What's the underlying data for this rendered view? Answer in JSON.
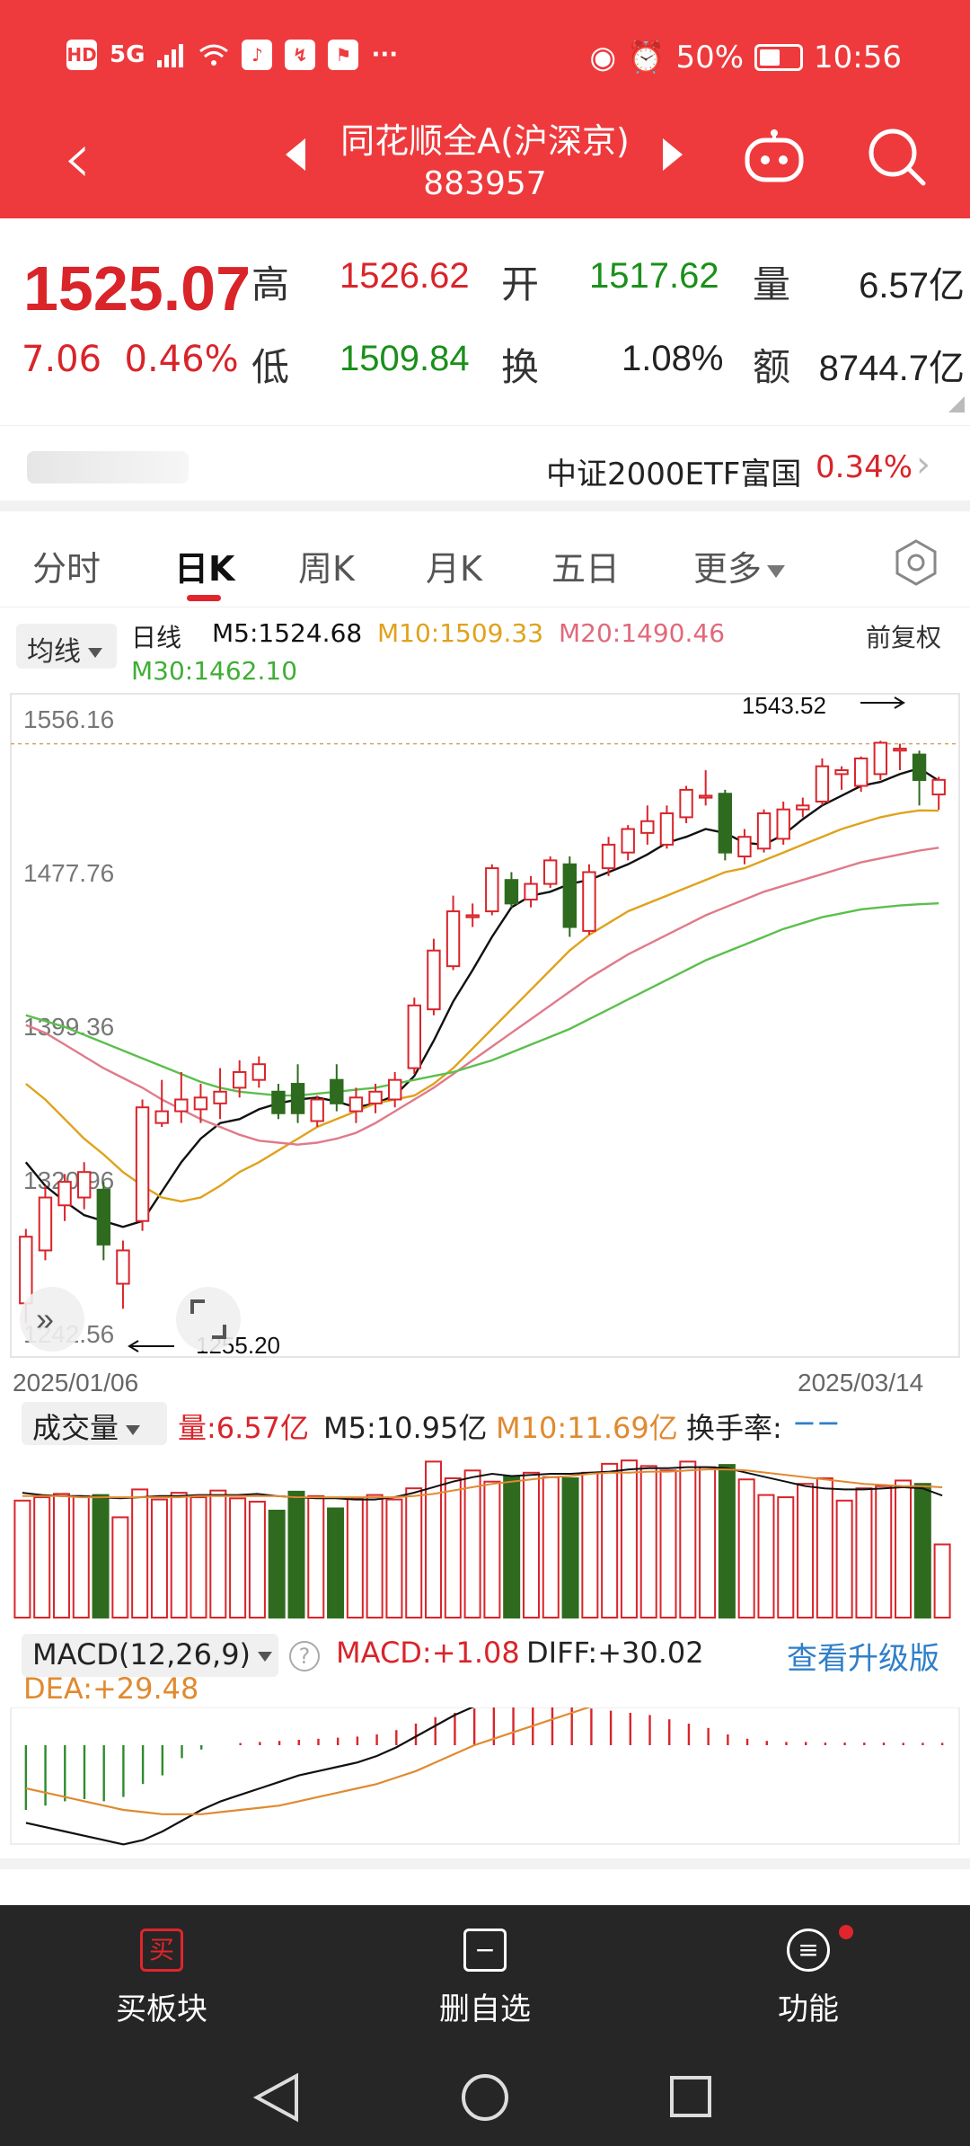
{
  "status_bar": {
    "left_badges": [
      "HD",
      "5G"
    ],
    "battery": "50%",
    "time": "10:56",
    "more": "···"
  },
  "header": {
    "stock_name": "同花顺全A(沪深京)",
    "stock_code": "883957"
  },
  "quote": {
    "price": "1525.07",
    "change": "7.06",
    "change_pct": "0.46%",
    "high_label": "高",
    "high": "1526.62",
    "open_label": "开",
    "open": "1517.62",
    "volume_label": "量",
    "volume": "6.57亿",
    "low_label": "低",
    "low": "1509.84",
    "turnover_label": "换",
    "turnover": "1.08%",
    "amount_label": "额",
    "amount": "8744.7亿"
  },
  "etf": {
    "name": "中证2000ETF富国",
    "pct": "0.34%"
  },
  "tabs": [
    {
      "label": "分时"
    },
    {
      "label": "日K"
    },
    {
      "label": "周K"
    },
    {
      "label": "月K"
    },
    {
      "label": "五日"
    },
    {
      "label": "更多"
    }
  ],
  "ma_legend": {
    "selector": "均线",
    "period": "日线",
    "m5": "M5:1524.68",
    "m10": "M10:1509.33",
    "m20": "M20:1490.46",
    "m30": "M30:1462.10",
    "adjust": "前复权"
  },
  "colors": {
    "up": "#d9242a",
    "down": "#2e6b1f",
    "m5": "#111111",
    "m10": "#e0a21b",
    "m20": "#e07a8a",
    "m30": "#5cbf4d",
    "header": "#ee3a3d"
  },
  "chart_data": [
    {
      "type": "candlestick",
      "y_ticks": [
        "1556.16",
        "1477.76",
        "1399.36",
        "1320.96",
        "1242.56"
      ],
      "x_start": "2025/01/06",
      "x_end": "2025/03/14",
      "annotations": {
        "high": "1543.52",
        "low": "1255.20"
      },
      "candles": [
        [
          1258,
          1292,
          1248,
          1296
        ],
        [
          1285,
          1312,
          1280,
          1318
        ],
        [
          1308,
          1320,
          1300,
          1324
        ],
        [
          1312,
          1325,
          1306,
          1330
        ],
        [
          1316,
          1288,
          1280,
          1320
        ],
        [
          1268,
          1285,
          1255.2,
          1290
        ],
        [
          1300,
          1358,
          1295,
          1362
        ],
        [
          1350,
          1356,
          1348,
          1372
        ],
        [
          1356,
          1362,
          1350,
          1376
        ],
        [
          1357,
          1363,
          1350,
          1370
        ],
        [
          1360,
          1366,
          1352,
          1378
        ],
        [
          1368,
          1376,
          1363,
          1382
        ],
        [
          1372,
          1380,
          1368,
          1384
        ],
        [
          1366,
          1355,
          1352,
          1370
        ],
        [
          1370,
          1355,
          1350,
          1380
        ],
        [
          1351,
          1362,
          1348,
          1364
        ],
        [
          1372,
          1360,
          1356,
          1380
        ],
        [
          1356,
          1363,
          1350,
          1368
        ],
        [
          1360,
          1366,
          1355,
          1370
        ],
        [
          1362,
          1372,
          1358,
          1376
        ],
        [
          1378,
          1410,
          1375,
          1414
        ],
        [
          1408,
          1438,
          1405,
          1444
        ],
        [
          1430,
          1458,
          1428,
          1466
        ],
        [
          1455,
          1456,
          1450,
          1462
        ],
        [
          1458,
          1480,
          1456,
          1482
        ],
        [
          1474,
          1462,
          1460,
          1478
        ],
        [
          1464,
          1472,
          1460,
          1476
        ],
        [
          1472,
          1484,
          1470,
          1486
        ],
        [
          1482,
          1450,
          1445,
          1486
        ],
        [
          1448,
          1478,
          1446,
          1482
        ],
        [
          1480,
          1492,
          1476,
          1496
        ],
        [
          1488,
          1500,
          1484,
          1502
        ],
        [
          1498,
          1504,
          1492,
          1512
        ],
        [
          1492,
          1508,
          1490,
          1512
        ],
        [
          1506,
          1520,
          1503,
          1522
        ],
        [
          1516,
          1517,
          1512,
          1530
        ],
        [
          1518,
          1488,
          1484,
          1520
        ],
        [
          1486,
          1496,
          1482,
          1500
        ],
        [
          1490,
          1508,
          1488,
          1510
        ],
        [
          1495,
          1510,
          1492,
          1514
        ],
        [
          1510,
          1512,
          1506,
          1516
        ],
        [
          1514,
          1532,
          1512,
          1536
        ],
        [
          1528,
          1530,
          1520,
          1532
        ],
        [
          1522,
          1536,
          1519,
          1537
        ],
        [
          1528,
          1544,
          1525,
          1545
        ],
        [
          1540,
          1541,
          1530,
          1543.52
        ],
        [
          1538,
          1525,
          1512,
          1540
        ],
        [
          1517.62,
          1525.07,
          1509.84,
          1526.62
        ]
      ],
      "ma": {
        "M5": [
          1330,
          1318,
          1310,
          1303,
          1300,
          1297,
          1300,
          1315,
          1330,
          1342,
          1350,
          1352,
          1357,
          1360,
          1362,
          1363,
          1361,
          1358,
          1360,
          1364,
          1374,
          1392,
          1412,
          1428,
          1445,
          1460,
          1466,
          1468,
          1472,
          1474,
          1478,
          1482,
          1487,
          1493,
          1496,
          1500,
          1498,
          1493,
          1492,
          1497,
          1505,
          1512,
          1517,
          1522,
          1524,
          1528,
          1531,
          1524.68
        ],
        "M10": [
          1370,
          1362,
          1352,
          1342,
          1334,
          1325,
          1318,
          1312,
          1310,
          1312,
          1318,
          1325,
          1330,
          1336,
          1342,
          1348,
          1352,
          1356,
          1360,
          1362,
          1364,
          1370,
          1378,
          1388,
          1398,
          1408,
          1418,
          1428,
          1438,
          1446,
          1452,
          1458,
          1462,
          1466,
          1470,
          1474,
          1478,
          1480,
          1484,
          1488,
          1492,
          1496,
          1500,
          1503,
          1506,
          1508,
          1509.5,
          1509.33
        ],
        "M20": [
          1400,
          1396,
          1390,
          1384,
          1378,
          1373,
          1368,
          1362,
          1357,
          1352,
          1348,
          1344,
          1341,
          1340,
          1339,
          1340,
          1342,
          1345,
          1350,
          1356,
          1362,
          1368,
          1375,
          1382,
          1389,
          1396,
          1403,
          1410,
          1417,
          1424,
          1430,
          1436,
          1441,
          1446,
          1451,
          1456,
          1460,
          1464,
          1468,
          1471,
          1474,
          1477,
          1480,
          1483,
          1485,
          1487,
          1489,
          1490.46
        ],
        "M30": [
          1405,
          1402,
          1399,
          1395,
          1391,
          1387,
          1383,
          1379,
          1375,
          1371,
          1368,
          1366,
          1365,
          1364,
          1364,
          1365,
          1366,
          1367,
          1368,
          1370,
          1372,
          1374,
          1376,
          1379,
          1382,
          1386,
          1390,
          1394,
          1398,
          1403,
          1408,
          1413,
          1418,
          1423,
          1428,
          1433,
          1437,
          1441,
          1445,
          1449,
          1452,
          1455,
          1457,
          1459,
          1460,
          1461,
          1461.6,
          1462.1
        ]
      }
    },
    {
      "type": "bar",
      "name": "volume",
      "selector": "成交量",
      "vol": "量:6.57亿",
      "m5": "M5:10.95亿",
      "m10": "M10:11.69亿",
      "turnover": "换手率:",
      "turnover_val": "−−",
      "values": [
        10.5,
        10.8,
        11.1,
        10.9,
        11.0,
        9.0,
        11.5,
        10.6,
        11.2,
        10.8,
        11.4,
        10.7,
        10.4,
        9.6,
        11.3,
        10.9,
        9.8,
        10.7,
        11.0,
        10.6,
        11.6,
        14.0,
        12.5,
        13.2,
        12.2,
        12.7,
        13.0,
        12.6,
        12.5,
        13.0,
        13.8,
        14.1,
        13.6,
        13.2,
        14.0,
        13.5,
        13.7,
        12.4,
        11.0,
        10.8,
        12.0,
        12.5,
        10.5,
        11.6,
        11.8,
        12.3,
        12.0,
        6.57
      ],
      "m5_line": [
        11.2,
        11.0,
        10.9,
        10.9,
        10.8,
        10.7,
        10.8,
        10.9,
        10.9,
        11.0,
        11.0,
        11.0,
        11.1,
        10.9,
        10.8,
        10.7,
        10.7,
        10.6,
        10.6,
        10.8,
        11.2,
        11.7,
        12.2,
        12.6,
        12.9,
        12.7,
        12.8,
        12.9,
        12.9,
        13.0,
        13.1,
        13.3,
        13.4,
        13.4,
        13.5,
        13.5,
        13.4,
        13.0,
        12.6,
        12.2,
        11.8,
        11.6,
        11.5,
        11.5,
        11.6,
        11.7,
        11.6,
        10.95
      ],
      "m10_line": [
        10.9,
        10.9,
        10.9,
        10.8,
        10.8,
        10.8,
        10.8,
        10.8,
        10.8,
        10.9,
        10.9,
        10.9,
        10.9,
        10.9,
        10.8,
        10.8,
        10.8,
        10.8,
        10.8,
        10.8,
        10.9,
        11.1,
        11.4,
        11.7,
        12.0,
        12.2,
        12.4,
        12.6,
        12.7,
        12.9,
        13.0,
        13.0,
        13.1,
        13.1,
        13.2,
        13.3,
        13.3,
        13.2,
        13.0,
        12.8,
        12.6,
        12.4,
        12.2,
        12.0,
        11.9,
        11.8,
        11.8,
        11.69
      ]
    },
    {
      "type": "line",
      "name": "MACD",
      "selector": "MACD(12,26,9)",
      "macd": "MACD:+1.08",
      "diff": "DIFF:+30.02",
      "dea": "DEA:+29.48",
      "upgrade": "查看升级版",
      "hist": [
        -30,
        -28,
        -26,
        -25,
        -26,
        -24,
        -18,
        -14,
        -6,
        -2,
        0,
        1,
        1.5,
        2,
        2.5,
        3,
        3.5,
        4,
        5,
        7,
        10,
        13,
        15,
        17,
        18,
        19,
        20,
        20,
        18,
        17,
        16,
        15,
        14,
        12,
        10,
        8,
        5,
        3,
        2,
        1.5,
        1.5,
        1.2,
        1.2,
        1.2,
        1.2,
        1.1,
        1.1,
        1.08
      ],
      "diff_line": [
        -36,
        -38,
        -40,
        -42,
        -44,
        -46,
        -44,
        -40,
        -35,
        -30,
        -26,
        -23,
        -20,
        -17,
        -14,
        -12,
        -10,
        -8,
        -5,
        -1,
        4,
        9,
        14,
        18,
        22,
        25,
        28,
        31,
        32,
        34,
        36,
        37,
        38,
        38,
        37,
        35,
        34,
        33,
        32,
        32,
        31.5,
        31,
        31,
        30.8,
        30.6,
        30.4,
        30.2,
        30.02
      ],
      "dea_line": [
        -20,
        -22,
        -24,
        -26,
        -28,
        -30,
        -31,
        -32,
        -32,
        -32,
        -31,
        -30,
        -29,
        -28,
        -26,
        -24,
        -22,
        -20,
        -18,
        -15,
        -12,
        -8,
        -4,
        0,
        3,
        6,
        9,
        12,
        15,
        18,
        20,
        22,
        24,
        25,
        26,
        27,
        28,
        28.5,
        29,
        29.2,
        29.3,
        29.4,
        29.4,
        29.45,
        29.5,
        29.5,
        29.5,
        29.48
      ]
    }
  ],
  "bottom_bar": {
    "buy_icon": "买",
    "buy_label": "买板块",
    "remove_label": "删自选",
    "func_label": "功能"
  }
}
